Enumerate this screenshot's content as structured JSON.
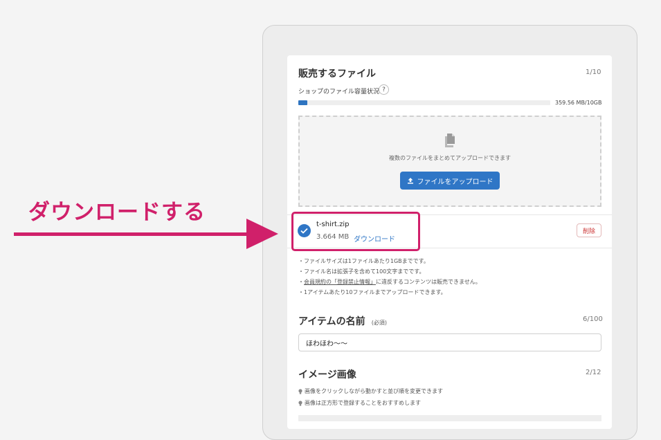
{
  "callout": {
    "label": "ダウンロードする"
  },
  "files_section": {
    "title": "販売するファイル",
    "count": "1/10",
    "capacity_label": "ショップのファイル容量状況",
    "help_icon": "?",
    "capacity_used_fraction": 0.035,
    "capacity_text": "359.56 MB/10GB",
    "dropzone_text": "複数のファイルをまとめてアップロードできます",
    "upload_button": "ファイルをアップロード"
  },
  "file": {
    "name": "t-shirt.zip",
    "size": "3.664 MB",
    "download_label": "ダウンロード",
    "delete_label": "削除"
  },
  "notes": {
    "line1": "・ファイルサイズは1ファイルあたり1GBまでです。",
    "line2": "・ファイル名は拡張子を含めて100文字までです。",
    "line3_pre": "・",
    "line3_link1": "会員規約の「登録禁止情報」",
    "line3_post": "に違反するコンテンツは販売できません。",
    "line4": "・1アイテムあたり10ファイルまでアップロードできます。"
  },
  "item_name": {
    "title": "アイテムの名前",
    "required": "(必須)",
    "count": "6/100",
    "value": "ほわほわ〜〜"
  },
  "image_section": {
    "title": "イメージ画像",
    "count": "2/12",
    "tip1": "画像をクリックしながら動かすと並び順を変更できます",
    "tip2": "画像は正方形で登録することをおすすめします"
  },
  "colors": {
    "accent": "#2f76c6",
    "callout": "#d0206a",
    "danger": "#cc3333"
  }
}
